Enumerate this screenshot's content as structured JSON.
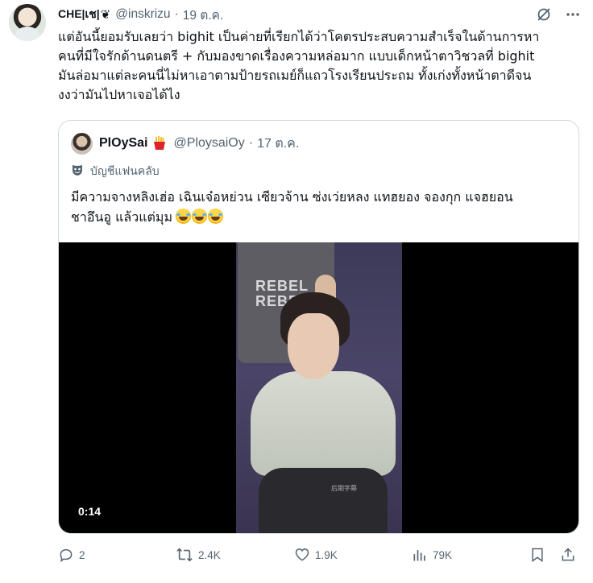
{
  "tweet": {
    "display_name": "CHE|เช|",
    "name_symbol": "❦",
    "handle": "@inskrizu",
    "separator": "·",
    "date": "19 ต.ค.",
    "text": "แต่อันนี้ยอมรับเลยว่า bighit เป็นค่ายที่เรียกได้ว่าโคตรประสบความสำเร็จในด้านการหา\nคนที่มีใจรักด้านดนตรี + กับมองขาดเรื่องความหล่อมาก แบบเด็กหน้าตาวิชวลที่ bighit\nมันล่อมาแต่ละคนนี่ไม่หาเอาตามป้ายรถเมย์ก็แถวโรงเรียนประถม ทั้งเก่งทั้งหน้าตาดีจน\nงงว่ามันไปหาเจอได้ไง"
  },
  "quote": {
    "display_name": "PlOySai",
    "badge_icon": "french-fries-emoji",
    "handle": "@PloysaiOy",
    "separator": "·",
    "date": "17 ต.ค.",
    "fan_label": "บัญชีแฟนคลับ",
    "text_line1": "มีความจางหลิงเฮ่อ เฉินเจ๋อหย่วน เซียวจ้าน ซ่งเว่ยหลง แทฮยอง จองกุก แจฮยอน",
    "text_line2": "ชาอึนอู แล้วแต่มุม",
    "video_duration": "0:14",
    "shirt_text": "REBEL\nREBEL",
    "watermark": "后期字幕"
  },
  "actions": {
    "replies": "2",
    "reposts": "2.4K",
    "likes": "1.9K",
    "views": "79K"
  }
}
